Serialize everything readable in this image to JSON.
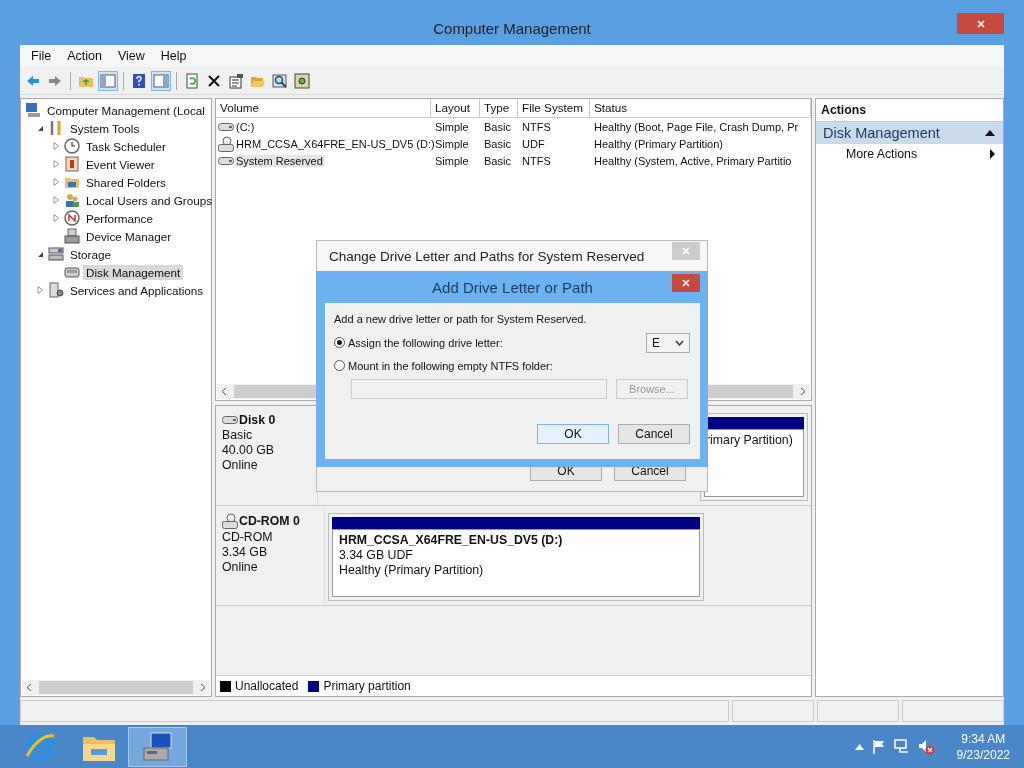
{
  "window": {
    "title": "Computer Management"
  },
  "menu": [
    "File",
    "Action",
    "View",
    "Help"
  ],
  "toolbar": [
    {
      "kind": "back",
      "pressed": false
    },
    {
      "kind": "forward",
      "pressed": false
    },
    {
      "kind": "sep"
    },
    {
      "kind": "up",
      "pressed": false
    },
    {
      "kind": "tree",
      "pressed": true
    },
    {
      "kind": "sep"
    },
    {
      "kind": "help",
      "pressed": false
    },
    {
      "kind": "pane",
      "pressed": true
    },
    {
      "kind": "sep"
    },
    {
      "kind": "refresh",
      "pressed": false
    },
    {
      "kind": "delete",
      "pressed": false
    },
    {
      "kind": "properties",
      "pressed": false
    },
    {
      "kind": "open",
      "pressed": false
    },
    {
      "kind": "search",
      "pressed": false
    },
    {
      "kind": "settings",
      "pressed": false
    }
  ],
  "tree": [
    {
      "label": "Computer Management (Local",
      "kind": "root",
      "selected": false,
      "children": [
        {
          "label": "System Tools",
          "kind": "branch",
          "expanded": true,
          "selected": false,
          "children": [
            {
              "label": "Task Scheduler",
              "kind": "branch",
              "expanded": false,
              "selected": false
            },
            {
              "label": "Event Viewer",
              "kind": "branch",
              "expanded": false,
              "selected": false
            },
            {
              "label": "Shared Folders",
              "kind": "branch",
              "expanded": false,
              "selected": false
            },
            {
              "label": "Local Users and Groups",
              "kind": "branch",
              "expanded": false,
              "selected": false
            },
            {
              "label": "Performance",
              "kind": "branch",
              "expanded": false,
              "selected": false
            },
            {
              "label": "Device Manager",
              "kind": "leaf",
              "selected": false
            }
          ]
        },
        {
          "label": "Storage",
          "kind": "branch",
          "expanded": true,
          "selected": false,
          "children": [
            {
              "label": "Disk Management",
              "kind": "leaf",
              "selected": true
            }
          ]
        },
        {
          "label": "Services and Applications",
          "kind": "branch",
          "expanded": false,
          "selected": false
        }
      ]
    }
  ],
  "table": {
    "columns": [
      "Volume",
      "Layout",
      "Type",
      "File System",
      "Status"
    ],
    "rows": [
      {
        "kind": "disk",
        "selected": false,
        "cells": [
          "(C:)",
          "Simple",
          "Basic",
          "NTFS",
          "Healthy (Boot, Page File, Crash Dump, Pr"
        ]
      },
      {
        "kind": "cdrom",
        "selected": false,
        "cells": [
          "HRM_CCSA_X64FRE_EN-US_DV5 (D:)",
          "Simple",
          "Basic",
          "UDF",
          "Healthy (Primary Partition)"
        ]
      },
      {
        "kind": "disk",
        "selected": true,
        "cells": [
          "System Reserved",
          "Simple",
          "Basic",
          "NTFS",
          "Healthy (System, Active, Primary Partitio"
        ]
      }
    ]
  },
  "disks": [
    {
      "kind": "disk",
      "name": "Disk 0",
      "type": "Basic",
      "size": "40.00 GB",
      "state": "Online",
      "partitions": [
        {
          "color": "#000080",
          "lines": [
            "rimary Partition)"
          ]
        }
      ]
    },
    {
      "kind": "cdrom",
      "name": "CD-ROM 0",
      "type": "CD-ROM",
      "size": "3.34 GB",
      "state": "Online",
      "partitions": [
        {
          "color": "#000080",
          "title": "HRM_CCSA_X64FRE_EN-US_DV5  (D:)",
          "lines": [
            "3.34 GB UDF",
            "Healthy (Primary Partition)"
          ]
        }
      ]
    }
  ],
  "legend": [
    {
      "label": "Unallocated",
      "color": "#000000"
    },
    {
      "label": "Primary partition",
      "color": "#000080"
    }
  ],
  "actions": {
    "header": "Actions",
    "section": {
      "title": "Disk Management",
      "expanded": true
    },
    "items": [
      "More Actions"
    ]
  },
  "back_dialog": {
    "title": "Change Drive Letter and Paths for System Reserved",
    "buttons": [
      "OK",
      "Cancel"
    ]
  },
  "dialog": {
    "title": "Add Drive Letter or Path",
    "prompt": "Add a new drive letter or path for System Reserved.",
    "options": [
      {
        "label": "Assign the following drive letter:",
        "selected": true
      },
      {
        "label": "Mount in the following empty NTFS folder:",
        "selected": false
      }
    ],
    "drive_letter": "E",
    "browse": {
      "label": "Browse...",
      "disabled": true
    },
    "buttons": [
      "OK",
      "Cancel"
    ]
  },
  "taskbar": {
    "apps": [
      {
        "kind": "browser",
        "active": false
      },
      {
        "kind": "explorer",
        "active": false
      },
      {
        "kind": "management",
        "active": true
      }
    ],
    "time": "9:34 AM",
    "date": "9/23/2022"
  }
}
